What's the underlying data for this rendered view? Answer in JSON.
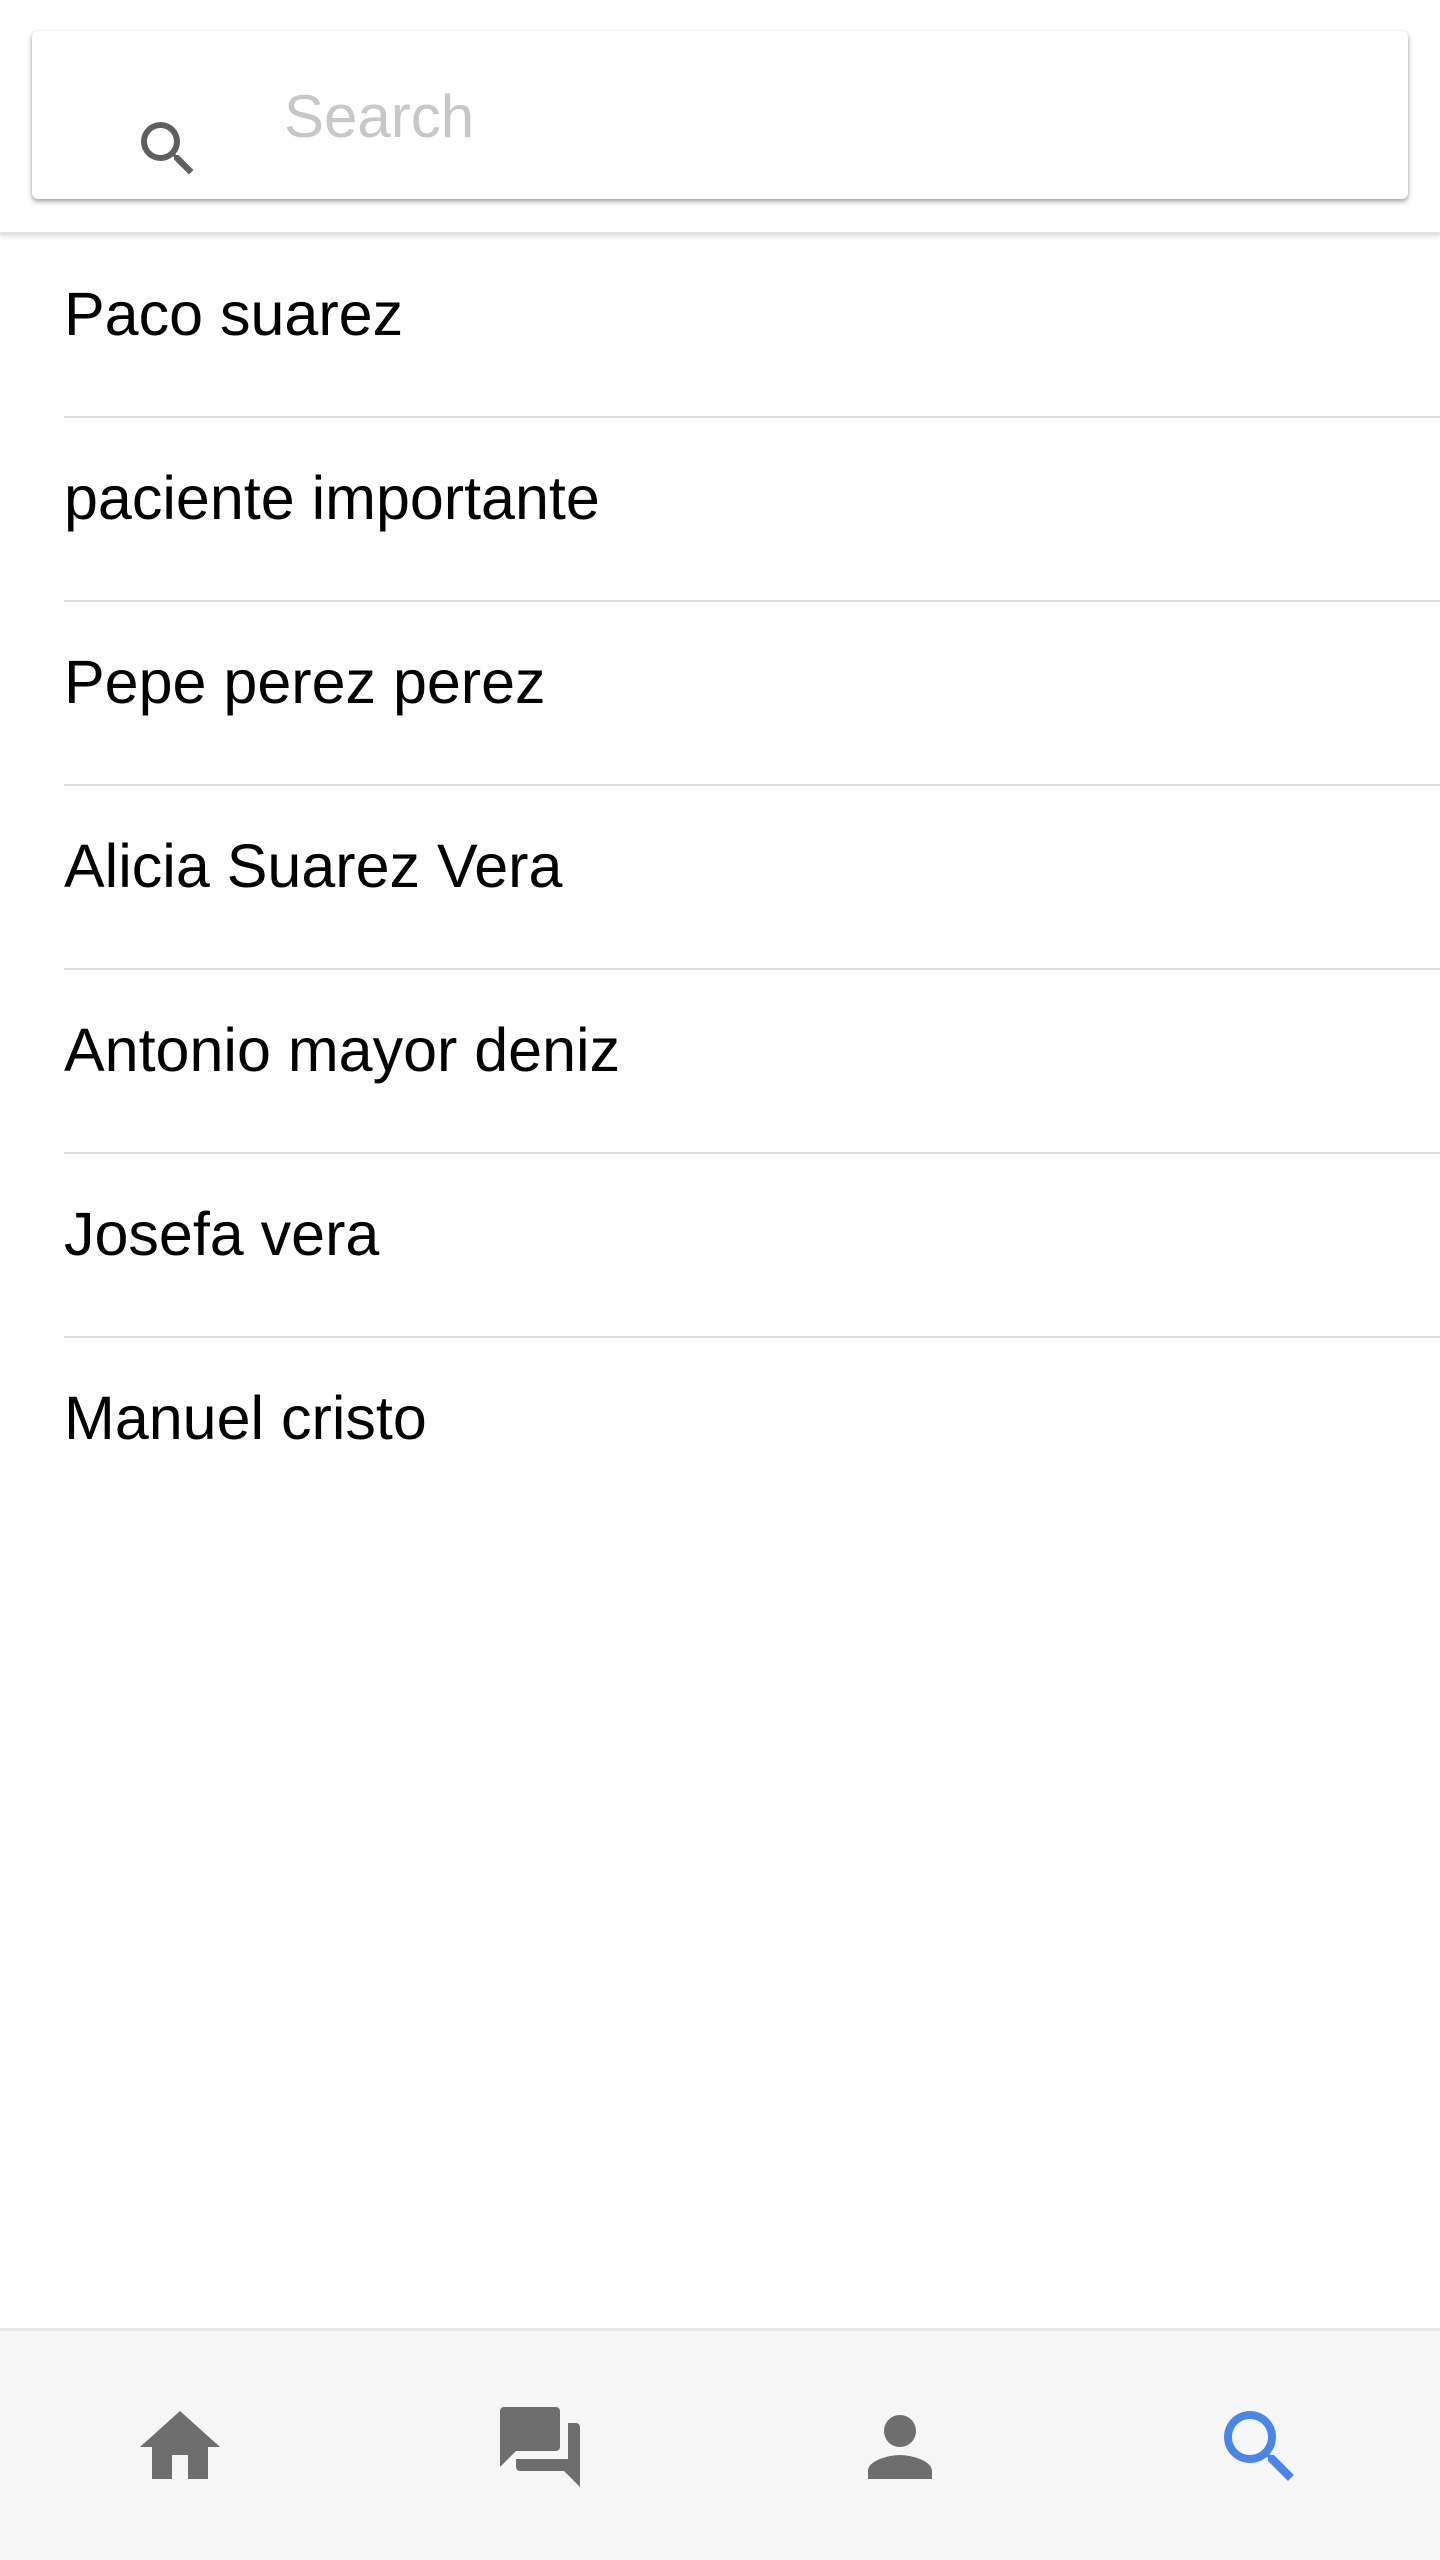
{
  "search": {
    "placeholder": "Search",
    "value": "",
    "icon": "search-icon"
  },
  "list": {
    "items": [
      {
        "label": "Paco suarez"
      },
      {
        "label": "paciente importante"
      },
      {
        "label": "Pepe perez perez"
      },
      {
        "label": "Alicia Suarez Vera"
      },
      {
        "label": "Antonio mayor deniz"
      },
      {
        "label": "Josefa vera"
      },
      {
        "label": "Manuel cristo"
      }
    ]
  },
  "tabbar": {
    "tabs": [
      {
        "name": "home",
        "icon": "home-icon",
        "active": false
      },
      {
        "name": "chat",
        "icon": "chat-icon",
        "active": false
      },
      {
        "name": "profile",
        "icon": "person-icon",
        "active": false
      },
      {
        "name": "search",
        "icon": "search-icon",
        "active": true
      }
    ],
    "active_color": "#4a86e8",
    "inactive_color": "#6e6e6e"
  }
}
